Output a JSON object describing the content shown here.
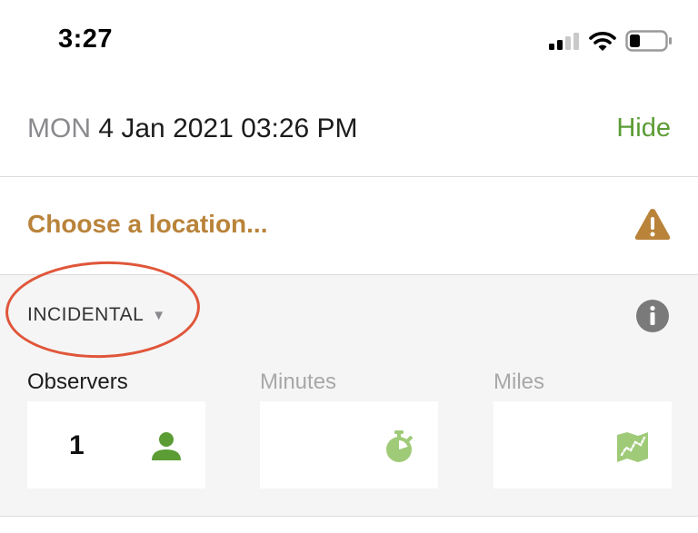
{
  "status_bar": {
    "time": "3:27",
    "icons": [
      "cellular-signal-icon",
      "wifi-icon",
      "battery-icon"
    ]
  },
  "header": {
    "day": "MON",
    "date_time": "4 Jan 2021 03:26 PM",
    "hide_label": "Hide"
  },
  "location": {
    "placeholder": "Choose a location...",
    "icon": "warning-icon"
  },
  "protocol": {
    "selected": "INCIDENTAL",
    "caret": "▼",
    "info_icon": "info-icon"
  },
  "fields": {
    "observers": {
      "label": "Observers",
      "value": "1",
      "icon": "person-icon"
    },
    "minutes": {
      "label": "Minutes",
      "value": "",
      "icon": "stopwatch-icon"
    },
    "miles": {
      "label": "Miles",
      "value": "",
      "icon": "map-icon"
    }
  },
  "colors": {
    "accent_green": "#5b9c34",
    "location_orange": "#b9833a",
    "annotation_red": "#e0563a",
    "muted_green": "#9fcb78"
  }
}
